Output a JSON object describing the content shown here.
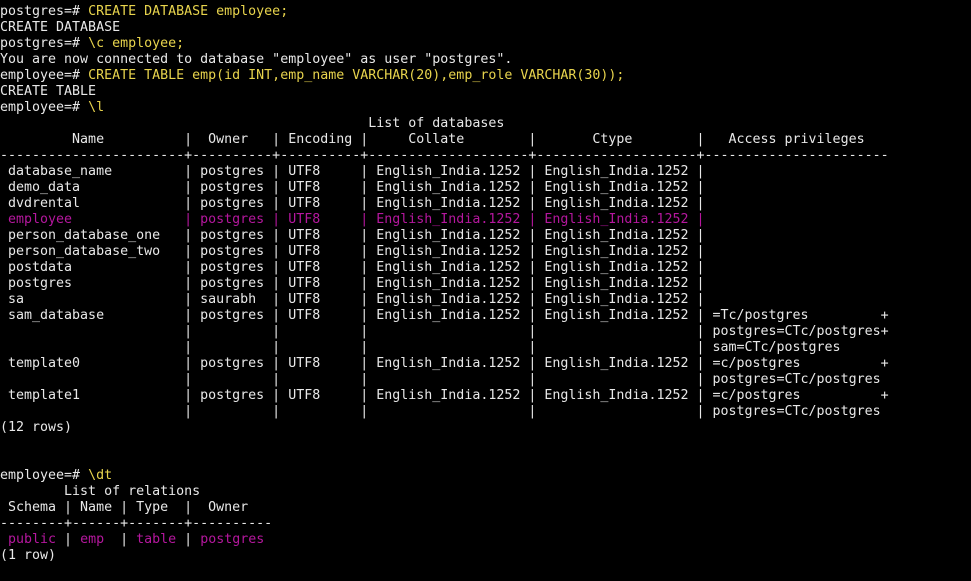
{
  "terminal": {
    "lines": [
      [
        {
          "t": "postgres=# "
        },
        {
          "t": "CREATE DATABASE employee;",
          "c": "yel"
        }
      ],
      [
        {
          "t": "CREATE DATABASE"
        }
      ],
      [
        {
          "t": "postgres=# "
        },
        {
          "t": "\\c employee;",
          "c": "yel"
        }
      ],
      [
        {
          "t": "You are now connected to database \"employee\" as user \"postgres\"."
        }
      ],
      [
        {
          "t": "employee=# "
        },
        {
          "t": "CREATE TABLE emp(id INT,emp_name VARCHAR(20),emp_role VARCHAR(30));",
          "c": "yel"
        }
      ],
      [
        {
          "t": "CREATE TABLE"
        }
      ],
      [
        {
          "t": "employee=# "
        },
        {
          "t": "\\l",
          "c": "yel"
        }
      ],
      [
        {
          "t": "                                              List of databases"
        }
      ],
      [
        {
          "t": "         Name          |  Owner   | Encoding |     Collate        |       Ctype        |   Access privileges"
        }
      ],
      [
        {
          "t": "-----------------------+----------+----------+--------------------+--------------------+-----------------------"
        }
      ],
      [
        {
          "t": " database_name         | postgres | UTF8     | English_India.1252 | English_India.1252 |"
        }
      ],
      [
        {
          "t": " demo_data             | postgres | UTF8     | English_India.1252 | English_India.1252 |"
        }
      ],
      [
        {
          "t": " dvdrental             | postgres | UTF8     | English_India.1252 | English_India.1252 |"
        }
      ],
      [
        {
          "t": " employee              | postgres | UTF8     | English_India.1252 | English_India.1252 |",
          "c": "mag"
        }
      ],
      [
        {
          "t": " person_database_one   | postgres | UTF8     | English_India.1252 | English_India.1252 |"
        }
      ],
      [
        {
          "t": " person_database_two   | postgres | UTF8     | English_India.1252 | English_India.1252 |"
        }
      ],
      [
        {
          "t": " postdata              | postgres | UTF8     | English_India.1252 | English_India.1252 |"
        }
      ],
      [
        {
          "t": " postgres              | postgres | UTF8     | English_India.1252 | English_India.1252 |"
        }
      ],
      [
        {
          "t": " sa                    | saurabh  | UTF8     | English_India.1252 | English_India.1252 |"
        }
      ],
      [
        {
          "t": " sam_database          | postgres | UTF8     | English_India.1252 | English_India.1252 | =Tc/postgres         +"
        }
      ],
      [
        {
          "t": "                       |          |          |                    |                    | postgres=CTc/postgres+"
        }
      ],
      [
        {
          "t": "                       |          |          |                    |                    | sam=CTc/postgres"
        }
      ],
      [
        {
          "t": " template0             | postgres | UTF8     | English_India.1252 | English_India.1252 | =c/postgres          +"
        }
      ],
      [
        {
          "t": "                       |          |          |                    |                    | postgres=CTc/postgres"
        }
      ],
      [
        {
          "t": " template1             | postgres | UTF8     | English_India.1252 | English_India.1252 | =c/postgres          +"
        }
      ],
      [
        {
          "t": "                       |          |          |                    |                    | postgres=CTc/postgres"
        }
      ],
      [
        {
          "t": "(12 rows)"
        }
      ],
      [
        {
          "t": ""
        }
      ],
      [
        {
          "t": ""
        }
      ],
      [
        {
          "t": "employee=# "
        },
        {
          "t": "\\dt",
          "c": "yel"
        }
      ],
      [
        {
          "t": "        List of relations"
        }
      ],
      [
        {
          "t": " Schema | Name | Type  |  Owner"
        }
      ],
      [
        {
          "t": "--------+------+-------+----------"
        }
      ],
      [
        {
          "t": " public",
          "c": "mag"
        },
        {
          "t": " | "
        },
        {
          "t": "emp",
          "c": "mag"
        },
        {
          "t": "  | "
        },
        {
          "t": "table",
          "c": "mag"
        },
        {
          "t": " | "
        },
        {
          "t": "postgres",
          "c": "mag"
        }
      ],
      [
        {
          "t": "(1 row)"
        }
      ],
      [
        {
          "t": ""
        }
      ]
    ]
  },
  "colors": {
    "background": "#000000",
    "text": "#e8e8e8",
    "command": "#e8d44d",
    "highlight": "#b5179e"
  }
}
